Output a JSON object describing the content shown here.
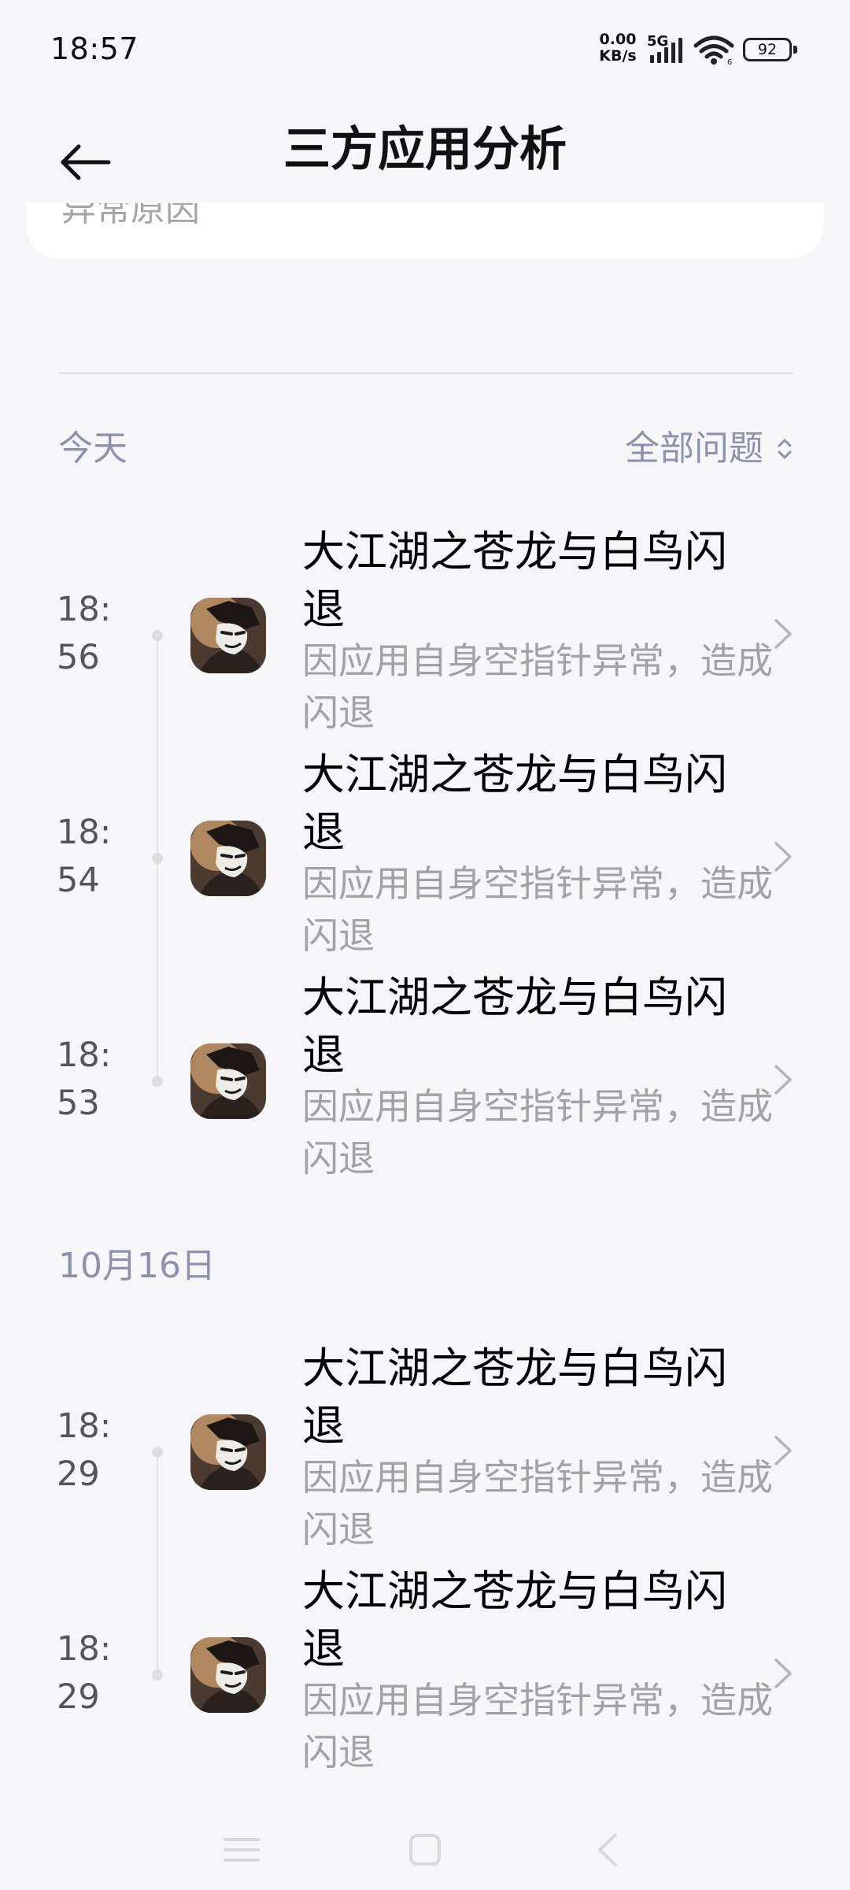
{
  "status_bar": {
    "time": "18:57",
    "net_speed_value": "0.00",
    "net_speed_unit": "KB/s",
    "network_type": "5G",
    "battery_level": "92",
    "icons": [
      "signal-icon",
      "wifi-icon",
      "battery-icon"
    ]
  },
  "header": {
    "title": "三方应用分析",
    "back_icon": "back-arrow-icon"
  },
  "card": {
    "label": "异常原因"
  },
  "sections": [
    {
      "date": "今天",
      "filter_label": "全部问题",
      "items": [
        {
          "time": "18:56",
          "title": "大江湖之苍龙与白鸟闪退",
          "description": "因应用自身空指针异常，造成闪退"
        },
        {
          "time": "18:54",
          "title": "大江湖之苍龙与白鸟闪退",
          "description": "因应用自身空指针异常，造成闪退"
        },
        {
          "time": "18:53",
          "title": "大江湖之苍龙与白鸟闪退",
          "description": "因应用自身空指针异常，造成闪退"
        }
      ]
    },
    {
      "date": "10月16日",
      "items": [
        {
          "time": "18:29",
          "title": "大江湖之苍龙与白鸟闪退",
          "description": "因应用自身空指针异常，造成闪退"
        },
        {
          "time": "18:29",
          "title": "大江湖之苍龙与白鸟闪退",
          "description": "因应用自身空指针异常，造成闪退"
        }
      ]
    }
  ],
  "nav_bar": {
    "icons": [
      "menu-icon",
      "home-icon",
      "back-icon"
    ]
  },
  "colors": {
    "background": "#f6f6f8",
    "section_label": "#8c91ad",
    "secondary_text": "#a2a2a2"
  }
}
